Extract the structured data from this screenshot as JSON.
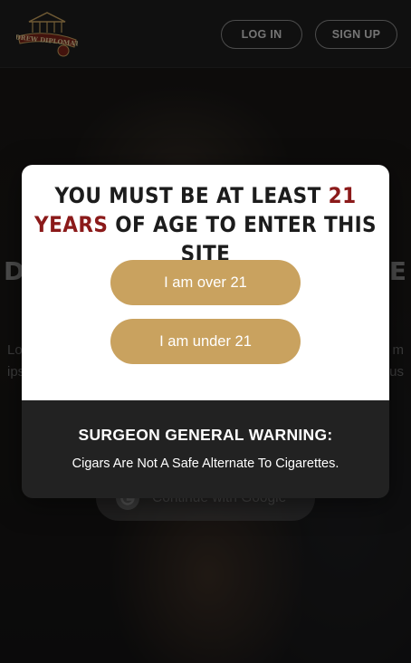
{
  "header": {
    "logo_text": "DREW DIPLOMAT",
    "login_label": "LOG IN",
    "signup_label": "SIGN UP"
  },
  "hero": {
    "title_left": "D",
    "title_right": "E",
    "text_left": [
      "Lo",
      "ips"
    ],
    "text_right": [
      "m",
      "us"
    ],
    "google_button_label": "Continue with Google"
  },
  "modal": {
    "heading_part1": "You must be at least ",
    "heading_highlight": "21 years",
    "heading_part2": " of age to enter this site",
    "over_21_label": "I am over 21",
    "under_21_label": "I am under 21",
    "warning_title": "SURGEON GENERAL WARNING:",
    "warning_text": "Cigars Are Not A Safe Alternate To Cigarettes."
  },
  "colors": {
    "accent_gold": "#c9a25f",
    "highlight_red": "#8b1a1a",
    "header_bg": "#1e1e1e",
    "warning_bg": "#222222"
  }
}
